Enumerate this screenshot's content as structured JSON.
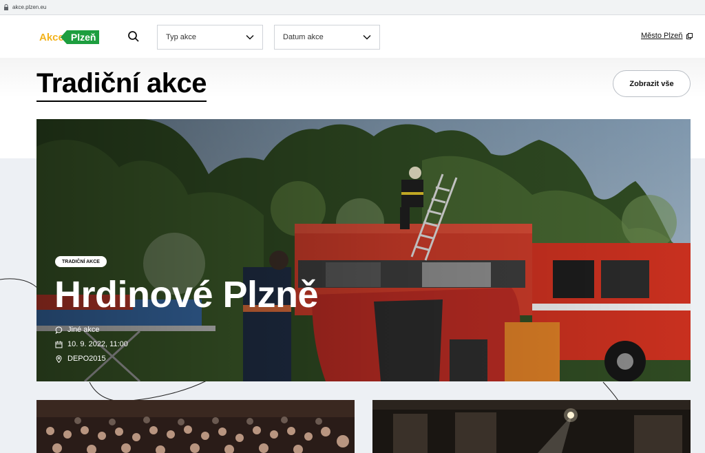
{
  "browser": {
    "url": "akce.plzen.eu"
  },
  "header": {
    "logo": {
      "part1": "Akce",
      "part2": "Plzeň"
    },
    "filters": [
      {
        "placeholder": "Typ akce"
      },
      {
        "placeholder": "Datum akce"
      }
    ],
    "city_link": "Město Plzeň"
  },
  "section": {
    "title": "Tradiční akce",
    "show_all": "Zobrazit vše"
  },
  "hero": {
    "badge": "TRADIČNÍ AKCE",
    "title": "Hrdinové Plzně",
    "category": "Jiné akce",
    "datetime": "10. 9. 2022, 11:00",
    "venue": "DEPO2015"
  },
  "colors": {
    "logo_yellow": "#f3b21b",
    "logo_green": "#1d9e3f"
  }
}
